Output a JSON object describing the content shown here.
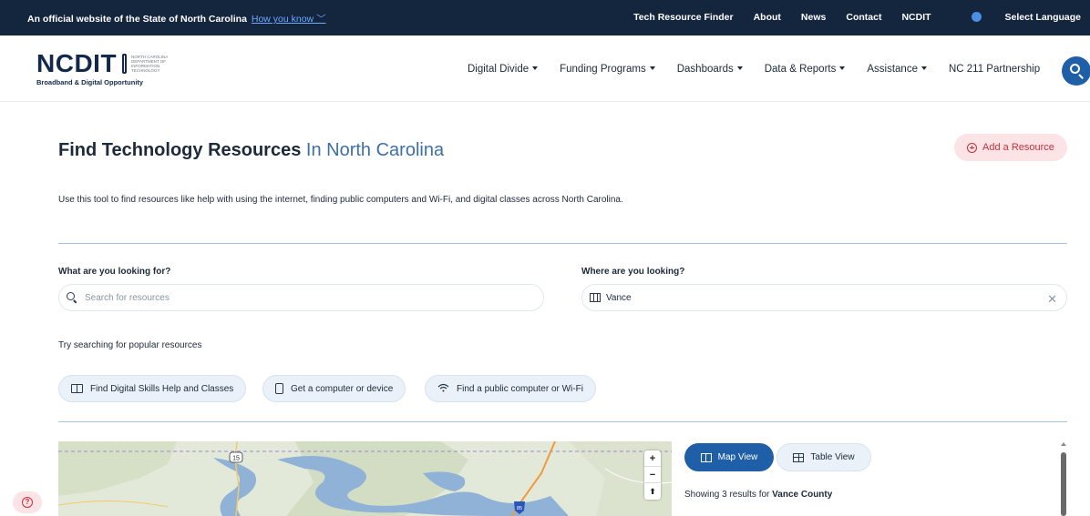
{
  "banner": {
    "official_text": "An official website of the State of North Carolina",
    "how_you_know": "How you know ",
    "links": [
      "Tech Resource Finder",
      "About",
      "News",
      "Contact",
      "NCDIT"
    ],
    "language": "Select Language"
  },
  "header": {
    "logo_text": "NCDIT",
    "logo_tiny": "NORTH CAROLINA DEPARTMENT OF INFORMATION TECHNOLOGY",
    "logo_sub": "Broadband & Digital Opportunity",
    "nav": [
      {
        "label": "Digital Divide",
        "dropdown": true
      },
      {
        "label": "Funding Programs",
        "dropdown": true
      },
      {
        "label": "Dashboards",
        "dropdown": true
      },
      {
        "label": "Data & Reports",
        "dropdown": true
      },
      {
        "label": "Assistance",
        "dropdown": true
      },
      {
        "label": "NC 211 Partnership",
        "dropdown": false
      }
    ]
  },
  "page": {
    "title_main": "Find Technology Resources",
    "title_accent": " In North Carolina",
    "add_resource": "Add a Resource",
    "description": "Use this tool to find resources like help with using the internet, finding public computers and Wi-Fi, and digital classes across North Carolina."
  },
  "search": {
    "what_label": "What are you looking for?",
    "what_placeholder": "Search for resources",
    "where_label": "Where are you looking?",
    "where_value": "Vance",
    "popular_label": "Try searching for popular resources",
    "chips": [
      {
        "label": "Find Digital Skills Help and Classes",
        "icon": "book-icon"
      },
      {
        "label": "Get a computer or device",
        "icon": "tablet-icon"
      },
      {
        "label": "Find a public computer or Wi-Fi",
        "icon": "wifi-icon"
      }
    ]
  },
  "map": {
    "zoom_in": "+",
    "zoom_out": "−",
    "reset": "⬆",
    "route_label": "15",
    "interstate_label": "85"
  },
  "results": {
    "map_view": "Map View",
    "table_view": "Table View",
    "showing_prefix": "Showing 3 results for ",
    "county": "Vance County"
  },
  "colors": {
    "banner_bg": "#14253e",
    "primary": "#1f5fa8",
    "accent_pink": "#fbe3e6",
    "accent_red": "#c8303d",
    "title_accent": "#3e6fa8"
  }
}
